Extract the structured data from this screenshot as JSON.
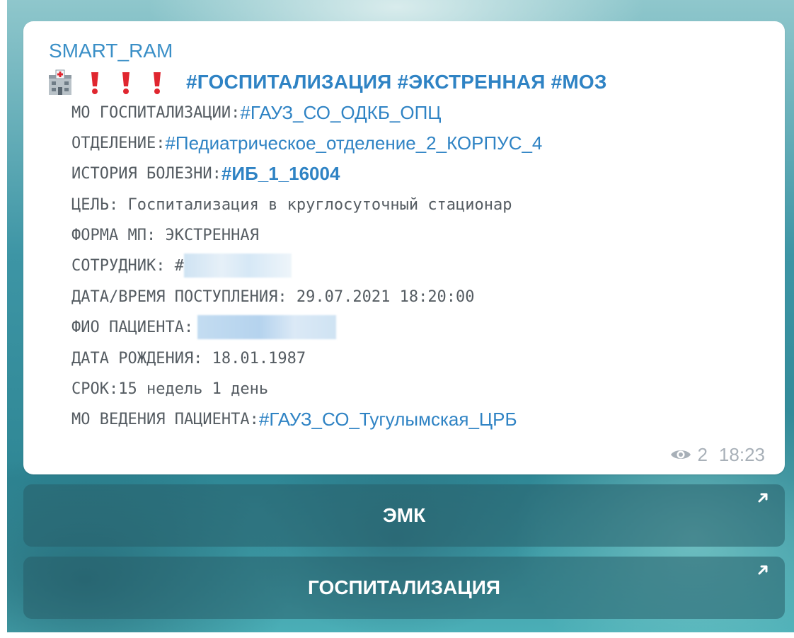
{
  "message": {
    "sender": "SMART_RAM",
    "headline_tags": "#ГОСПИТАЛИЗАЦИЯ #ЭКСТРЕННАЯ #МОЗ",
    "icons": [
      "hospital-icon",
      "exclamation-icon",
      "exclamation-icon",
      "exclamation-icon"
    ],
    "fields": {
      "mo_label": "МО ГОСПИТАЛИЗАЦИИ: ",
      "mo_value": "#ГАУЗ_СО_ОДКБ_ОПЦ",
      "dept_label": "ОТДЕЛЕНИЕ: ",
      "dept_value": "#Педиатрическое_отделение_2_КОРПУС_4",
      "history_label": "ИСТОРИЯ БОЛЕЗНИ: ",
      "history_value": "#ИБ_1_16004",
      "goal": "ЦЕЛЬ: Госпитализация в круглосуточный стационар",
      "form": "ФОРМА МП: ЭКСТРЕННАЯ",
      "employee_label": "СОТРУДНИК: #",
      "admission": "ДАТА/ВРЕМЯ ПОСТУПЛЕНИЯ: 29.07.2021 18:20:00",
      "patient_label": "ФИО ПАЦИЕНТА: ",
      "birth": "ДАТА РОЖДЕНИЯ: 18.01.1987",
      "term": "СРОК:15 недель 1 день",
      "mo_lead_label": "МО ВЕДЕНИЯ ПАЦИЕНТА: ",
      "mo_lead_value": "#ГАУЗ_СО_Тугулымская_ЦРБ"
    },
    "views": "2",
    "time": "18:23"
  },
  "buttons": {
    "emk": "ЭМК",
    "hospitalization": "ГОСПИТАЛИЗАЦИЯ"
  },
  "colors": {
    "link": "#2f83c4",
    "sender": "#3a8fc7",
    "mono_text": "#555c62",
    "meta": "#a8b0b8",
    "exclamation": "#e0262f"
  }
}
